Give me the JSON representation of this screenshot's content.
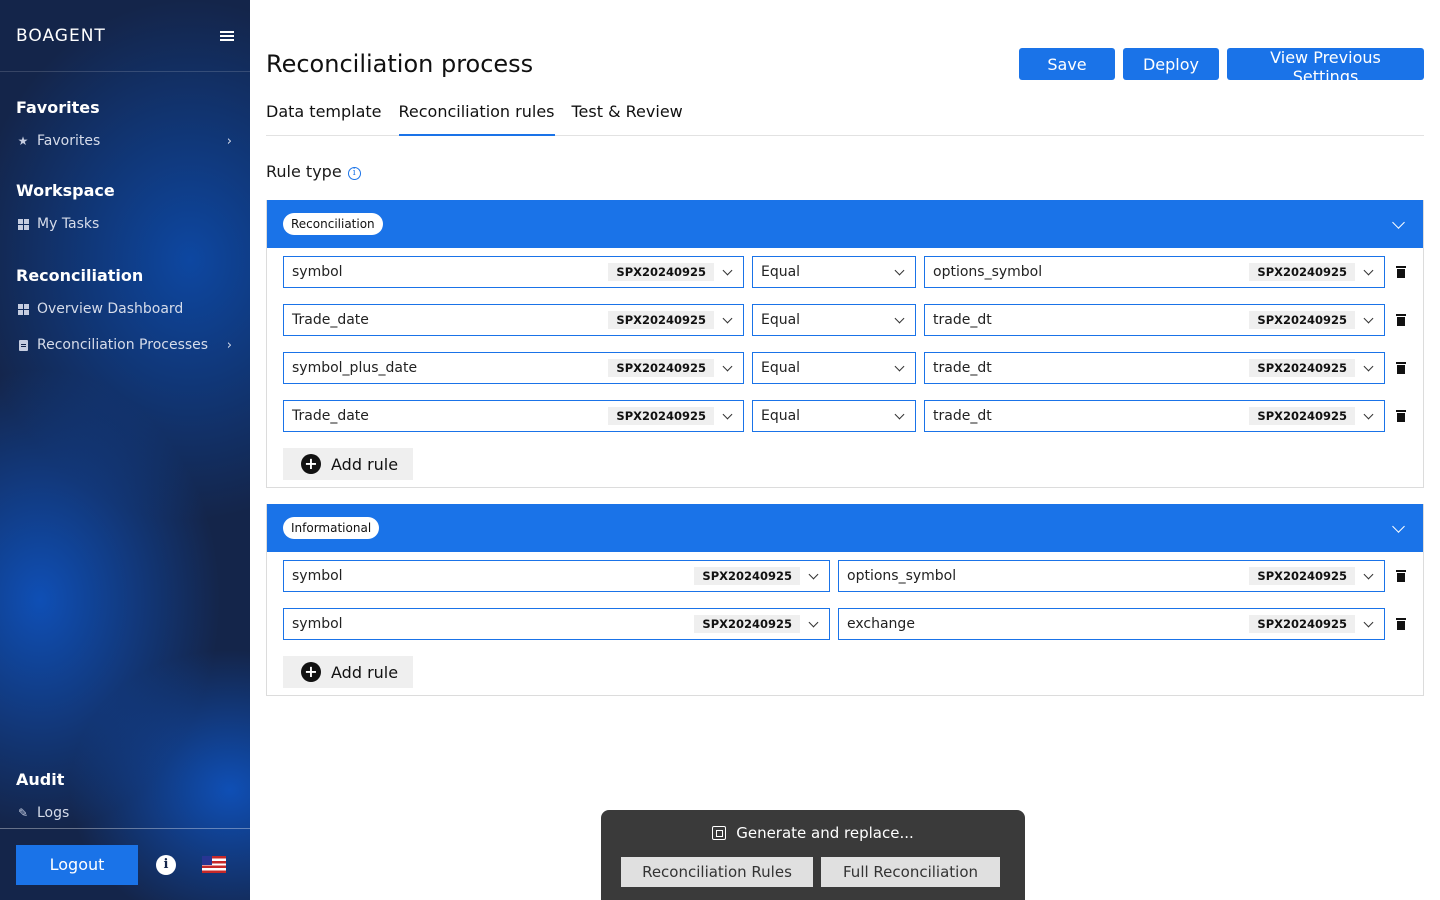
{
  "sidebar": {
    "brand": "BOAGENT",
    "sections": [
      {
        "heading": "Favorites",
        "items": [
          {
            "label": "Favorites",
            "icon": "star-icon",
            "has_chevron": true
          }
        ]
      },
      {
        "heading": "Workspace",
        "items": [
          {
            "label": "My Tasks",
            "icon": "grid-icon",
            "has_chevron": false
          }
        ]
      },
      {
        "heading": "Reconciliation",
        "items": [
          {
            "label": "Overview Dashboard",
            "icon": "grid-icon",
            "has_chevron": false
          },
          {
            "label": "Reconciliation Processes",
            "icon": "document-icon",
            "has_chevron": true
          }
        ]
      },
      {
        "heading": "Audit",
        "items": [
          {
            "label": "Logs",
            "icon": "pencil-icon",
            "has_chevron": false
          }
        ]
      }
    ],
    "footer": {
      "logout_label": "Logout",
      "info_glyph": "i",
      "language_flag": "us-flag-icon"
    }
  },
  "header": {
    "title": "Reconciliation process",
    "actions": {
      "save": "Save",
      "deploy": "Deploy",
      "previous": "View Previous Settings"
    }
  },
  "tabs": [
    {
      "label": "Data template",
      "active": false
    },
    {
      "label": "Reconciliation rules",
      "active": true
    },
    {
      "label": "Test & Review",
      "active": false
    }
  ],
  "rule_type_label": "Rule type",
  "reconciliation_panel": {
    "badge": "Reconciliation",
    "rules": [
      {
        "left": "symbol",
        "left_tag": "SPX20240925",
        "operator": "Equal",
        "right": "options_symbol",
        "right_tag": "SPX20240925"
      },
      {
        "left": "Trade_date",
        "left_tag": "SPX20240925",
        "operator": "Equal",
        "right": "trade_dt",
        "right_tag": "SPX20240925"
      },
      {
        "left": "symbol_plus_date",
        "left_tag": "SPX20240925",
        "operator": "Equal",
        "right": "trade_dt",
        "right_tag": "SPX20240925"
      },
      {
        "left": "Trade_date",
        "left_tag": "SPX20240925",
        "operator": "Equal",
        "right": "trade_dt",
        "right_tag": "SPX20240925"
      }
    ],
    "add_rule_label": "Add rule"
  },
  "informational_panel": {
    "badge": "Informational",
    "rules": [
      {
        "left": "symbol",
        "left_tag": "SPX20240925",
        "right": "options_symbol",
        "right_tag": "SPX20240925"
      },
      {
        "left": "symbol",
        "left_tag": "SPX20240925",
        "right": "exchange",
        "right_tag": "SPX20240925"
      }
    ],
    "add_rule_label": "Add rule"
  },
  "generate": {
    "title": "Generate and replace...",
    "rules_button": "Reconciliation Rules",
    "full_button": "Full Reconciliation"
  },
  "colors": {
    "primary": "#1a73e8",
    "sidebar_bg": "#14254a",
    "popup_bg": "#3a3a3a"
  }
}
